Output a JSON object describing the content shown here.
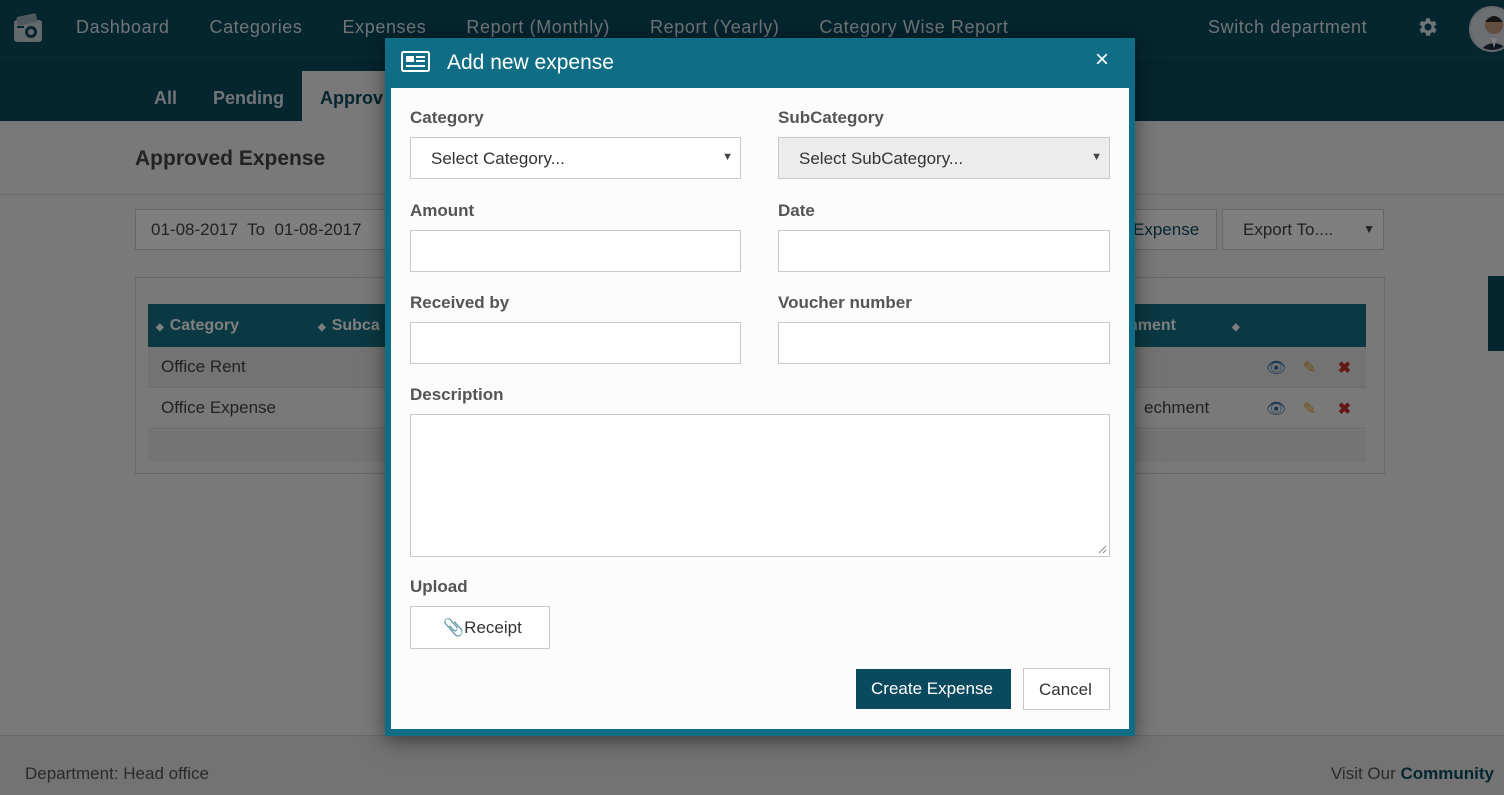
{
  "topnav": {
    "items": [
      "Dashboard",
      "Categories",
      "Expenses",
      "Report (Monthly)",
      "Report (Yearly)",
      "Category Wise Report"
    ],
    "switch_department": "Switch department"
  },
  "subtabs": [
    "All",
    "Pending",
    "Approv"
  ],
  "page": {
    "title": "Approved Expense",
    "date_from": "01-08-2017",
    "date_to_word": "To",
    "date_to": "01-08-2017",
    "add_button_partial": "Expense",
    "export_label": "Export To...."
  },
  "table": {
    "headers": [
      "Category",
      "Subca",
      "hment"
    ],
    "rows": [
      {
        "category": "Office Rent",
        "attachment": ""
      },
      {
        "category": "Office Expense",
        "attachment": "echment"
      }
    ]
  },
  "footer": {
    "department": "Department: Head office",
    "visit_prefix": "Visit Our",
    "community": "Community"
  },
  "modal": {
    "title": "Add new expense",
    "close": "×",
    "category_label": "Category",
    "category_placeholder": "Select Category...",
    "subcategory_label": "SubCategory",
    "subcategory_placeholder": "Select SubCategory...",
    "amount_label": "Amount",
    "amount_value": "",
    "date_label": "Date",
    "date_value": "",
    "received_label": "Received by",
    "received_value": "",
    "voucher_label": "Voucher number",
    "voucher_value": "",
    "description_label": "Description",
    "upload_label": "Upload",
    "receipt_button": "Receipt",
    "create_button": "Create Expense",
    "cancel_button": "Cancel"
  },
  "colors": {
    "brand": "#0b4a5e",
    "table_header": "#177387",
    "modal_frame": "#0f6e85"
  }
}
